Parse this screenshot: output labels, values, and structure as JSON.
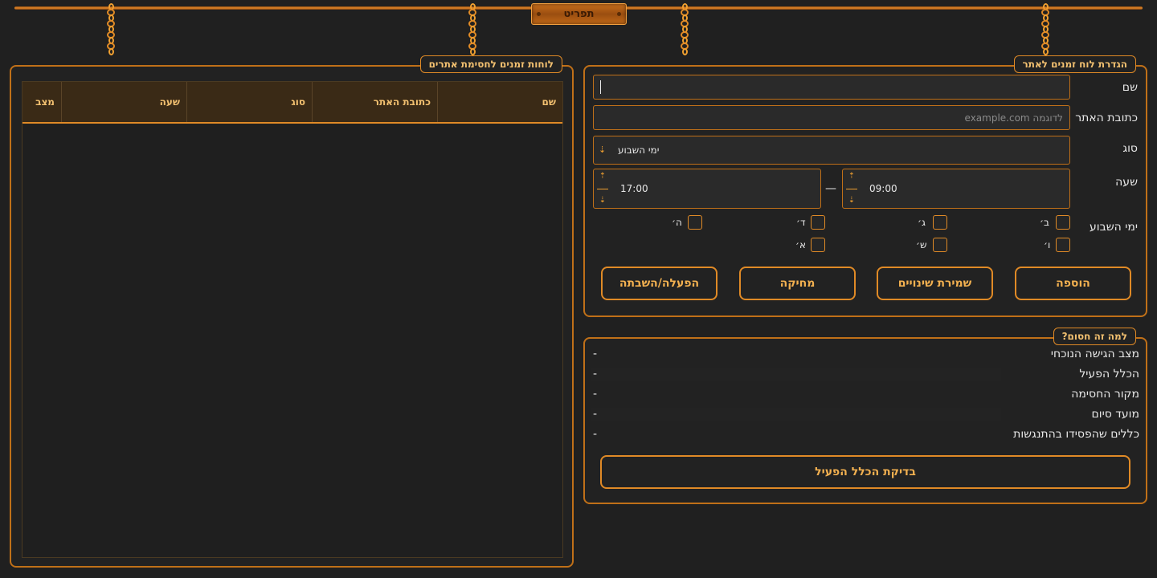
{
  "menu": {
    "label": "תפריט"
  },
  "schedules_panel": {
    "title": "לוחות זמנים לחסימת אתרים",
    "columns": [
      "שם",
      "כתובת האתר",
      "סוג",
      "שעה",
      "מצב"
    ]
  },
  "form_panel": {
    "title": "הגדרת לוח זמנים לאתר",
    "name_label": "שם",
    "name_value": "",
    "url_label": "כתובת האתר",
    "url_placeholder": "לדוגמה example.com",
    "type_label": "סוג",
    "type_value": "ימי השבוע",
    "time_label": "שעה",
    "time_start": "09:00",
    "time_end": "17:00",
    "time_separator": "—",
    "days_label": "ימי השבוע",
    "days": [
      "ב׳",
      "ג׳",
      "ד׳",
      "ה׳",
      "ו׳",
      "ש׳",
      "א׳"
    ],
    "buttons": {
      "add": "הוספה",
      "save": "שמירת שינויים",
      "delete": "מחיקה",
      "toggle": "הפעלה/השבתה"
    }
  },
  "why_panel": {
    "title": "?למה זה חסום",
    "rows": [
      {
        "label": "מצב הגישה הנוכחי",
        "value": "-"
      },
      {
        "label": "הכלל הפעיל",
        "value": "-"
      },
      {
        "label": "מקור החסימה",
        "value": "-"
      },
      {
        "label": "מועד סיום",
        "value": "-"
      },
      {
        "label": "כללים שהפסידו בהתנגשות",
        "value": "-"
      }
    ],
    "check_button": "בדיקת הכלל הפעיל"
  },
  "colors": {
    "accent": "#e08a26",
    "background": "#202020",
    "header": "#3a2a16"
  }
}
